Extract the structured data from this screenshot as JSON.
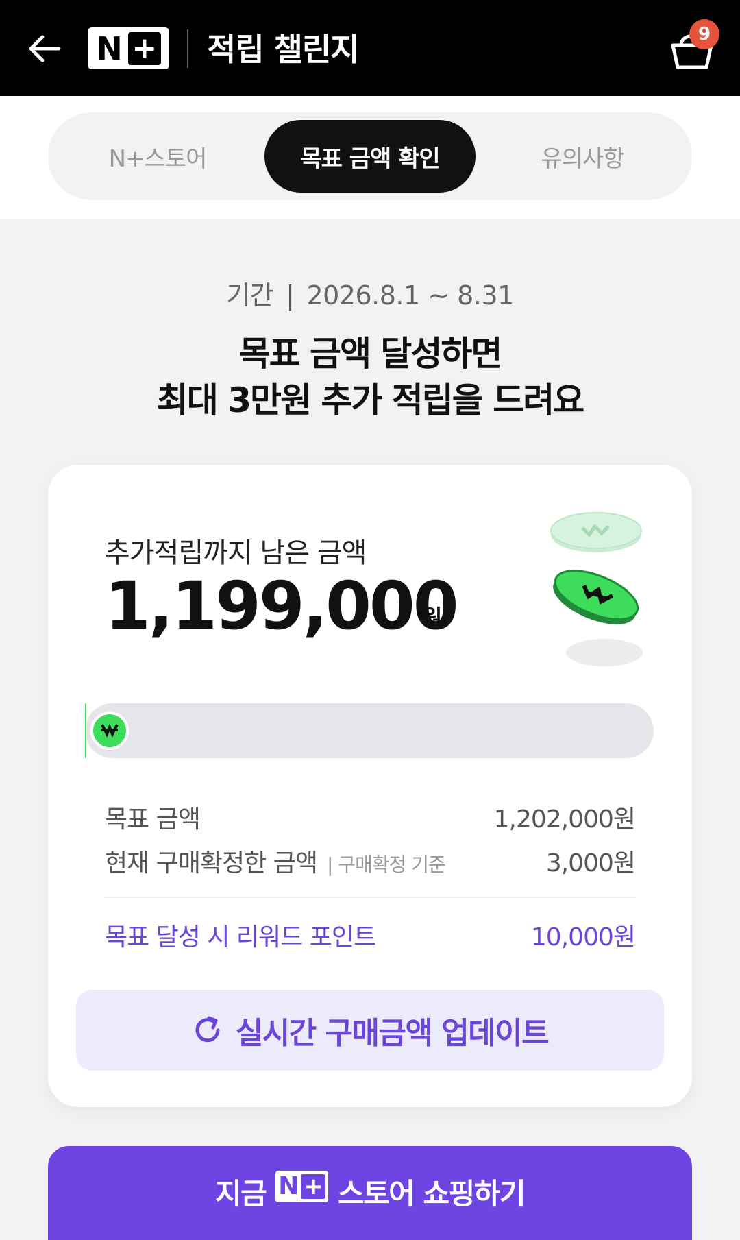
{
  "header": {
    "title": "적립 챌린지",
    "logo_letter": "N",
    "logo_plus": "+",
    "cart_count": "9"
  },
  "tabs": [
    {
      "label": "N+스토어",
      "active": false
    },
    {
      "label": "목표 금액 확인",
      "active": true
    },
    {
      "label": "유의사항",
      "active": false
    }
  ],
  "period": {
    "label": "기간",
    "separator": "|",
    "range": "2026.8.1 ~ 8.31"
  },
  "headline": {
    "line1": "목표 금액 달성하면",
    "line2": "최대 3만원 추가 적립을 드려요"
  },
  "card": {
    "remaining_label": "추가적립까지 남은 금액",
    "remaining_amount": "1,199,000",
    "currency": "원",
    "progress_percent": 0.25,
    "rows": [
      {
        "label": "목표 금액",
        "value": "1,202,000원"
      },
      {
        "label": "현재 구매확정한 금액",
        "note": "| 구매확정 기준",
        "value": "3,000원"
      },
      {
        "label": "목표 달성 시 리워드 포인트",
        "value": "10,000원"
      }
    ],
    "update_button": "실시간 구매금액 업데이트"
  },
  "cta": {
    "prefix": "지금",
    "logo_letter": "N",
    "logo_plus": "+",
    "suffix": "스토어 쇼핑하기"
  },
  "colors": {
    "accent": "#6e45e2",
    "accent_text": "#6a45d8",
    "coin_green": "#3ddc5a",
    "badge": "#e5533d"
  }
}
